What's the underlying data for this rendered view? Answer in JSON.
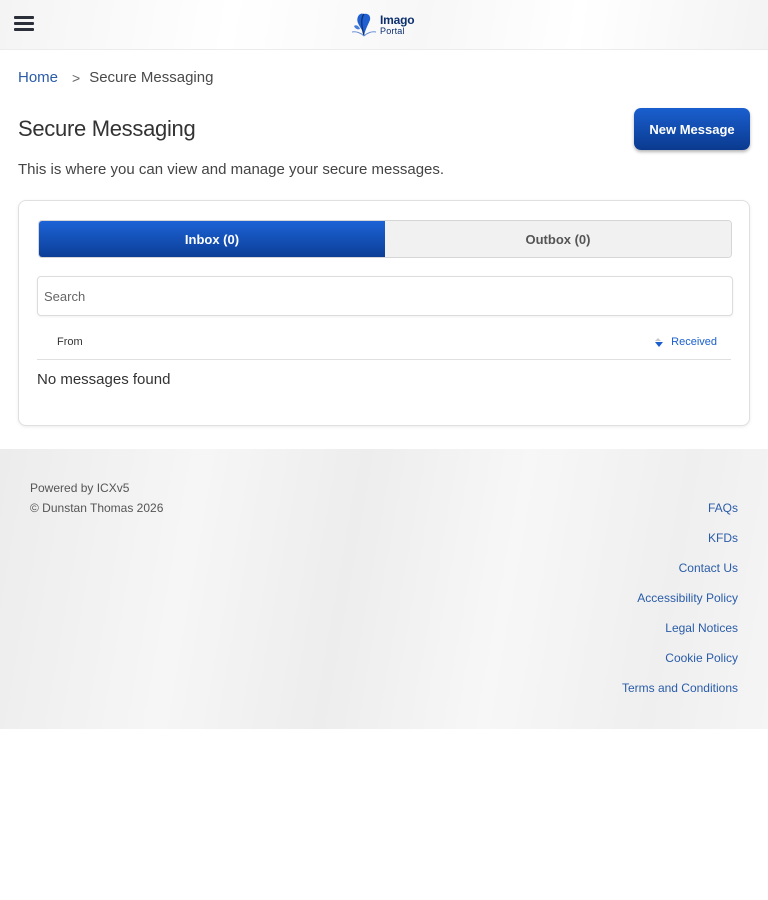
{
  "header": {
    "menu_icon": "hamburger-menu-icon",
    "logo_name": "Imago",
    "logo_sub": "Portal"
  },
  "breadcrumb": {
    "home": "Home",
    "separator": ">",
    "current": "Secure Messaging"
  },
  "page": {
    "title": "Secure Messaging",
    "new_message_label": "New Message",
    "description": "This is where you can view and manage your secure messages."
  },
  "messages": {
    "tabs": [
      {
        "label": "Inbox (0)",
        "active": true
      },
      {
        "label": "Outbox (0)",
        "active": false
      }
    ],
    "search_placeholder": "Search",
    "columns": {
      "from": "From",
      "received": "Received"
    },
    "empty_text": "No messages found"
  },
  "footer": {
    "powered_by": "Powered by ICXv5",
    "copyright": "© Dunstan Thomas 2026",
    "links": [
      "FAQs",
      "KFDs",
      "Contact Us",
      "Accessibility Policy",
      "Legal Notices",
      "Cookie Policy",
      "Terms and Conditions"
    ]
  },
  "colors": {
    "brand": "#0d2f6e",
    "accent": "#1a5fcf",
    "link": "#2a5ca8"
  }
}
